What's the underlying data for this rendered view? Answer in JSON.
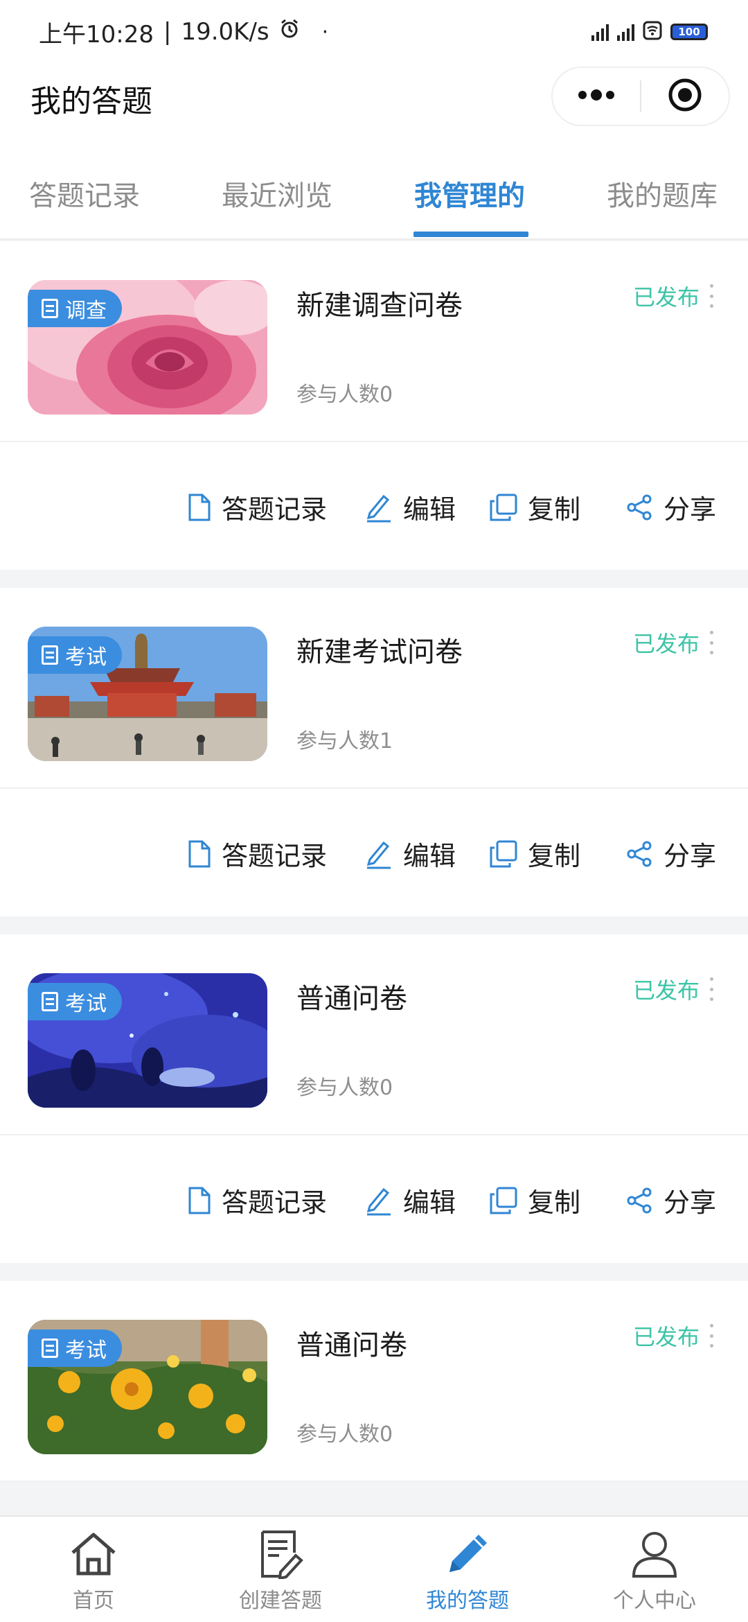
{
  "status_bar": {
    "time": "上午10:28",
    "speed": "19.0K/s",
    "battery": "100",
    "icons": [
      "alarm-icon",
      "signal-icon",
      "signal-icon",
      "wifi-icon",
      "battery-icon"
    ]
  },
  "header": {
    "title": "我的答题",
    "capsule_icons": [
      "more-icon",
      "record-icon"
    ]
  },
  "tabs": [
    {
      "label": "答题记录",
      "active": false
    },
    {
      "label": "最近浏览",
      "active": false
    },
    {
      "label": "我管理的",
      "active": true
    },
    {
      "label": "我的题库",
      "active": false
    }
  ],
  "cards": [
    {
      "badge": "调查",
      "title": "新建调查问卷",
      "status": "已发布",
      "count": "参与人数0",
      "thumb": "pink-rose-photo"
    },
    {
      "badge": "考试",
      "title": "新建考试问卷",
      "status": "已发布",
      "count": "参与人数1",
      "thumb": "temple-photo"
    },
    {
      "badge": "考试",
      "title": "普通问卷",
      "status": "已发布",
      "count": "参与人数0",
      "thumb": "blue-light-show-photo"
    },
    {
      "badge": "考试",
      "title": "普通问卷",
      "status": "已发布",
      "count": "参与人数0",
      "thumb": "yellow-flowers-photo"
    }
  ],
  "actions": {
    "records": "答题记录",
    "edit": "编辑",
    "copy": "复制",
    "share": "分享"
  },
  "bottom_nav": [
    {
      "label": "首页",
      "icon": "home-icon",
      "active": false
    },
    {
      "label": "创建答题",
      "icon": "create-form-icon",
      "active": false
    },
    {
      "label": "我的答题",
      "icon": "pencil-icon",
      "active": true
    },
    {
      "label": "个人中心",
      "icon": "person-icon",
      "active": false
    }
  ],
  "colors": {
    "accent": "#2f86d4",
    "status": "#3cc4a6",
    "badge": "#3b8ddf"
  }
}
